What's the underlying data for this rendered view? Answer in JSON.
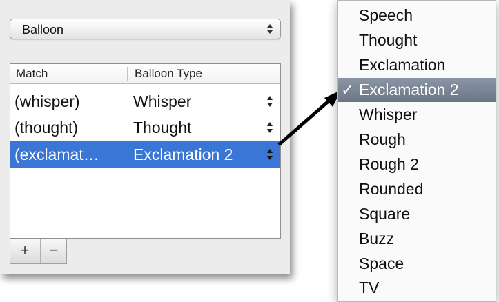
{
  "popup": {
    "value": "Balloon"
  },
  "table": {
    "columns": [
      "Match",
      "Balloon Type"
    ],
    "rows": [
      {
        "match": "(whisper)",
        "type": "Whisper",
        "selected": false
      },
      {
        "match": "(thought)",
        "type": "Thought",
        "selected": false
      },
      {
        "match": "(exclamat…",
        "type": "Exclamation 2",
        "selected": true
      }
    ]
  },
  "buttons": {
    "add": "+",
    "remove": "−"
  },
  "menu": {
    "items": [
      "Speech",
      "Thought",
      "Exclamation",
      "Exclamation 2",
      "Whisper",
      "Rough",
      "Rough 2",
      "Rounded",
      "Square",
      "Buzz",
      "Space",
      "TV"
    ],
    "selected": "Exclamation 2",
    "check_mark": "✓"
  },
  "colors": {
    "selection": "#3a76d6",
    "menu_highlight": "#7a8696"
  }
}
